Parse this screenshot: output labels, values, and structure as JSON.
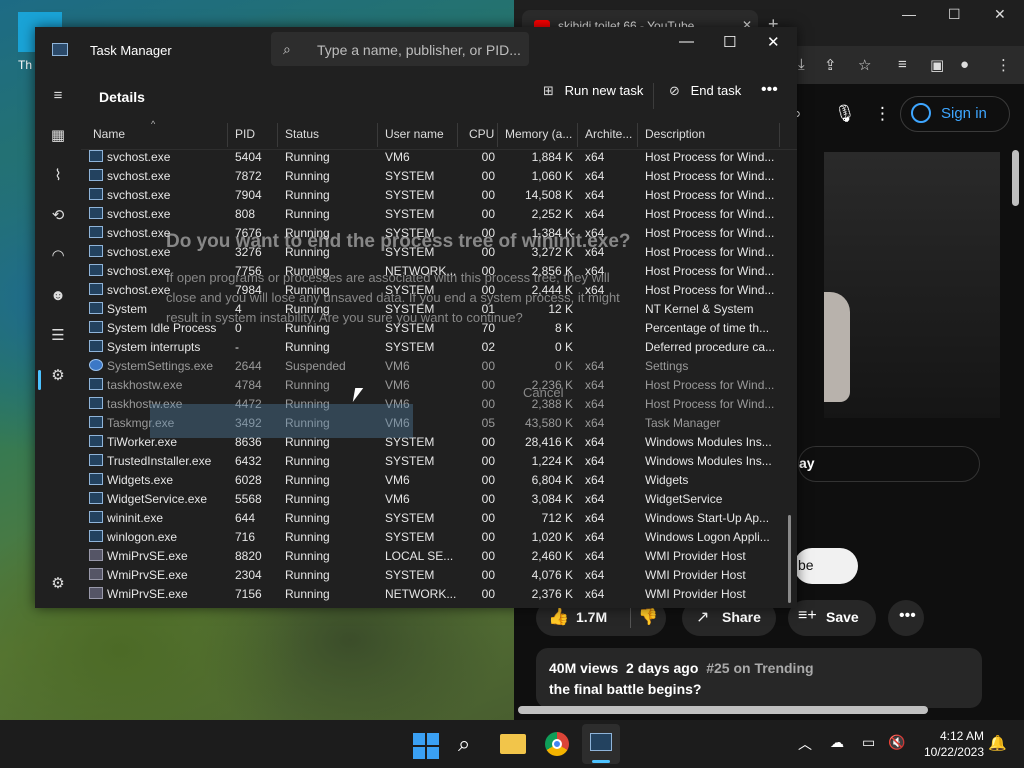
{
  "desktop": {
    "icon_label": "Th"
  },
  "browser": {
    "tab_title": "skibidi toilet 66 - YouTube",
    "signin_label": "Sign in",
    "subscribe_partial": "ay",
    "subscribe_pill_partial": "be",
    "like_count": "1.7M",
    "share_label": "Share",
    "save_label": "Save",
    "views": "40M views",
    "age": "2 days ago",
    "trending": "#25 on Trending",
    "video_title": "the final battle begins?"
  },
  "taskmanager": {
    "title": "Task Manager",
    "search_placeholder": "Type a name, publisher, or PID...",
    "page_title": "Details",
    "run_new_task": "Run new task",
    "end_task": "End task",
    "columns": [
      "Name",
      "PID",
      "Status",
      "User name",
      "CPU",
      "Memory (a...",
      "Archite...",
      "Description"
    ],
    "rows": [
      {
        "name": "svchost.exe",
        "pid": "5404",
        "status": "Running",
        "user": "VM6",
        "cpu": "00",
        "mem": "1,884 K",
        "arch": "x64",
        "desc": "Host Process for Wind..."
      },
      {
        "name": "svchost.exe",
        "pid": "7872",
        "status": "Running",
        "user": "SYSTEM",
        "cpu": "00",
        "mem": "1,060 K",
        "arch": "x64",
        "desc": "Host Process for Wind..."
      },
      {
        "name": "svchost.exe",
        "pid": "7904",
        "status": "Running",
        "user": "SYSTEM",
        "cpu": "00",
        "mem": "14,508 K",
        "arch": "x64",
        "desc": "Host Process for Wind..."
      },
      {
        "name": "svchost.exe",
        "pid": "808",
        "status": "Running",
        "user": "SYSTEM",
        "cpu": "00",
        "mem": "2,252 K",
        "arch": "x64",
        "desc": "Host Process for Wind..."
      },
      {
        "name": "svchost.exe",
        "pid": "7676",
        "status": "Running",
        "user": "SYSTEM",
        "cpu": "00",
        "mem": "1,384 K",
        "arch": "x64",
        "desc": "Host Process for Wind..."
      },
      {
        "name": "svchost.exe",
        "pid": "3276",
        "status": "Running",
        "user": "SYSTEM",
        "cpu": "00",
        "mem": "3,272 K",
        "arch": "x64",
        "desc": "Host Process for Wind..."
      },
      {
        "name": "svchost.exe",
        "pid": "7756",
        "status": "Running",
        "user": "NETWORK...",
        "cpu": "00",
        "mem": "2,856 K",
        "arch": "x64",
        "desc": "Host Process for Wind..."
      },
      {
        "name": "svchost.exe",
        "pid": "7984",
        "status": "Running",
        "user": "SYSTEM",
        "cpu": "00",
        "mem": "2,444 K",
        "arch": "x64",
        "desc": "Host Process for Wind..."
      },
      {
        "name": "System",
        "pid": "4",
        "status": "Running",
        "user": "SYSTEM",
        "cpu": "01",
        "mem": "12 K",
        "arch": "",
        "desc": "NT Kernel & System"
      },
      {
        "name": "System Idle Process",
        "pid": "0",
        "status": "Running",
        "user": "SYSTEM",
        "cpu": "70",
        "mem": "8 K",
        "arch": "",
        "desc": "Percentage of time th..."
      },
      {
        "name": "System interrupts",
        "pid": "-",
        "status": "Running",
        "user": "SYSTEM",
        "cpu": "02",
        "mem": "0 K",
        "arch": "",
        "desc": "Deferred procedure ca..."
      },
      {
        "name": "SystemSettings.exe",
        "pid": "2644",
        "status": "Suspended",
        "user": "VM6",
        "cpu": "00",
        "mem": "0 K",
        "arch": "x64",
        "desc": "Settings"
      },
      {
        "name": "taskhostw.exe",
        "pid": "4784",
        "status": "Running",
        "user": "VM6",
        "cpu": "00",
        "mem": "2,236 K",
        "arch": "x64",
        "desc": "Host Process for Wind..."
      },
      {
        "name": "taskhostw.exe",
        "pid": "4472",
        "status": "Running",
        "user": "VM6",
        "cpu": "00",
        "mem": "2,388 K",
        "arch": "x64",
        "desc": "Host Process for Wind..."
      },
      {
        "name": "Taskmgr.exe",
        "pid": "3492",
        "status": "Running",
        "user": "VM6",
        "cpu": "05",
        "mem": "43,580 K",
        "arch": "x64",
        "desc": "Task Manager"
      },
      {
        "name": "TiWorker.exe",
        "pid": "8636",
        "status": "Running",
        "user": "SYSTEM",
        "cpu": "00",
        "mem": "28,416 K",
        "arch": "x64",
        "desc": "Windows Modules Ins..."
      },
      {
        "name": "TrustedInstaller.exe",
        "pid": "6432",
        "status": "Running",
        "user": "SYSTEM",
        "cpu": "00",
        "mem": "1,224 K",
        "arch": "x64",
        "desc": "Windows Modules Ins..."
      },
      {
        "name": "Widgets.exe",
        "pid": "6028",
        "status": "Running",
        "user": "VM6",
        "cpu": "00",
        "mem": "6,804 K",
        "arch": "x64",
        "desc": "Widgets"
      },
      {
        "name": "WidgetService.exe",
        "pid": "5568",
        "status": "Running",
        "user": "VM6",
        "cpu": "00",
        "mem": "3,084 K",
        "arch": "x64",
        "desc": "WidgetService"
      },
      {
        "name": "wininit.exe",
        "pid": "644",
        "status": "Running",
        "user": "SYSTEM",
        "cpu": "00",
        "mem": "712 K",
        "arch": "x64",
        "desc": "Windows Start-Up Ap..."
      },
      {
        "name": "winlogon.exe",
        "pid": "716",
        "status": "Running",
        "user": "SYSTEM",
        "cpu": "00",
        "mem": "1,020 K",
        "arch": "x64",
        "desc": "Windows Logon Appli..."
      },
      {
        "name": "WmiPrvSE.exe",
        "pid": "8820",
        "status": "Running",
        "user": "LOCAL SE...",
        "cpu": "00",
        "mem": "2,460 K",
        "arch": "x64",
        "desc": "WMI Provider Host"
      },
      {
        "name": "WmiPrvSE.exe",
        "pid": "2304",
        "status": "Running",
        "user": "SYSTEM",
        "cpu": "00",
        "mem": "4,076 K",
        "arch": "x64",
        "desc": "WMI Provider Host"
      },
      {
        "name": "WmiPrvSE.exe",
        "pid": "7156",
        "status": "Running",
        "user": "NETWORK...",
        "cpu": "00",
        "mem": "2,376 K",
        "arch": "x64",
        "desc": "WMI Provider Host"
      }
    ]
  },
  "dialog": {
    "title": "Do you want to end the process tree of wininit.exe?",
    "line1": "If open programs or processes are associated with this process tree, they will",
    "line2": "close and you will lose any unsaved data. If you end a system process, it might",
    "line3": "result in system instability. Are you sure you want to continue?",
    "cancel": "Cancel"
  },
  "taskbar": {
    "time": "4:12 AM",
    "date": "10/22/2023"
  }
}
